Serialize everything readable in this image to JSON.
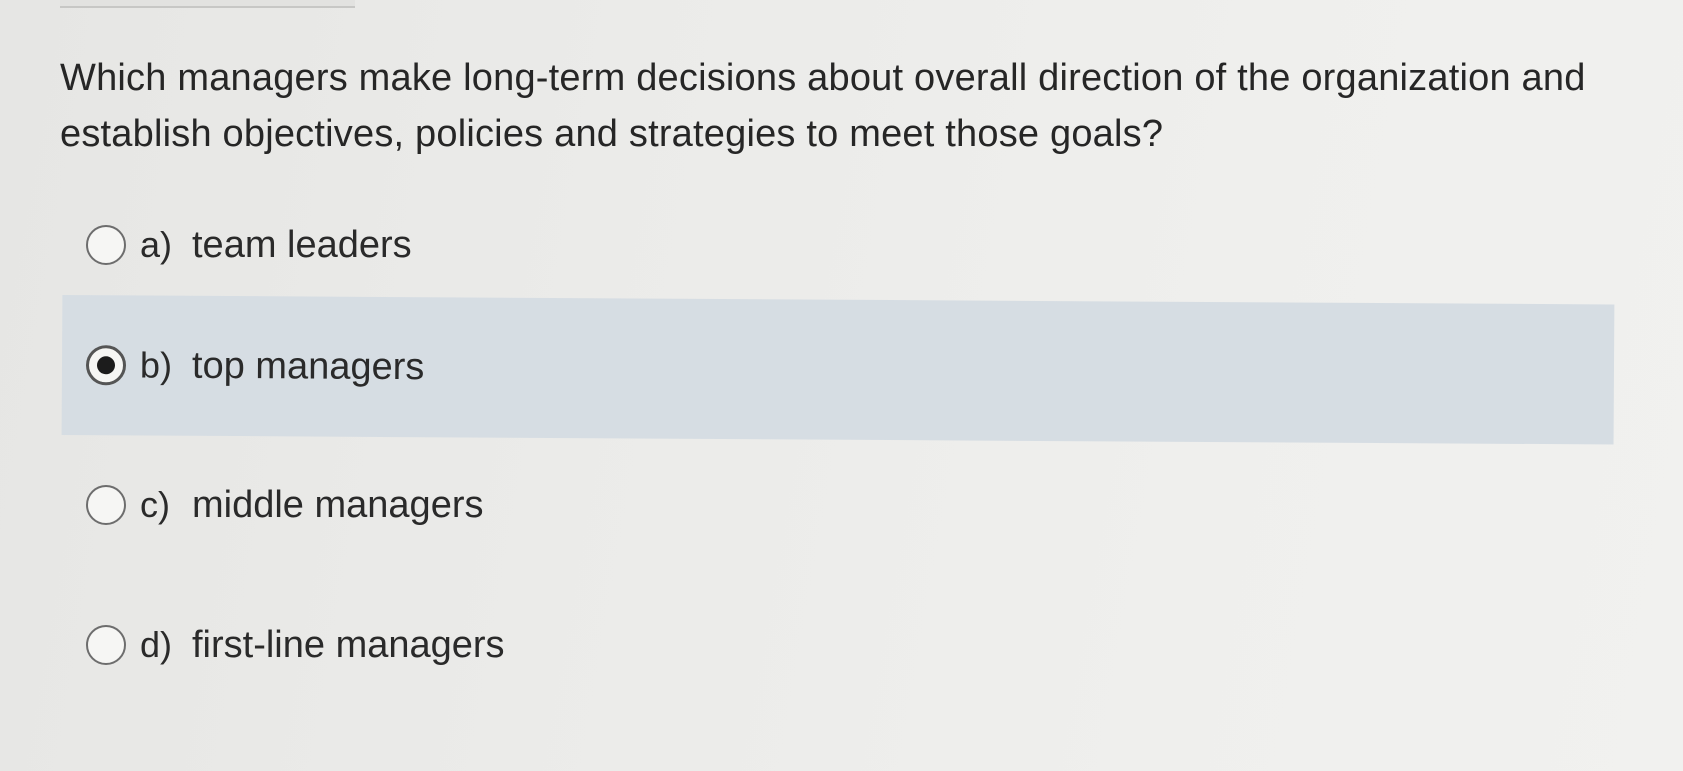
{
  "question": {
    "text": "Which managers make long-term decisions about overall direction of the organization and establish objectives, policies and strategies to meet those goals?"
  },
  "options": [
    {
      "letter": "a)",
      "text": "team leaders",
      "selected": false
    },
    {
      "letter": "b)",
      "text": "top managers",
      "selected": true
    },
    {
      "letter": "c)",
      "text": "middle managers",
      "selected": false
    },
    {
      "letter": "d)",
      "text": "first-line managers",
      "selected": false
    }
  ],
  "colors": {
    "background": "#ececea",
    "selected_highlight": "#d6dde3",
    "text": "#2a2a2a",
    "radio_border": "#6d6d6d",
    "radio_dot": "#1c1c1c"
  },
  "icons": {
    "radio_unselected": "radio-empty-icon",
    "radio_selected": "radio-filled-icon"
  }
}
